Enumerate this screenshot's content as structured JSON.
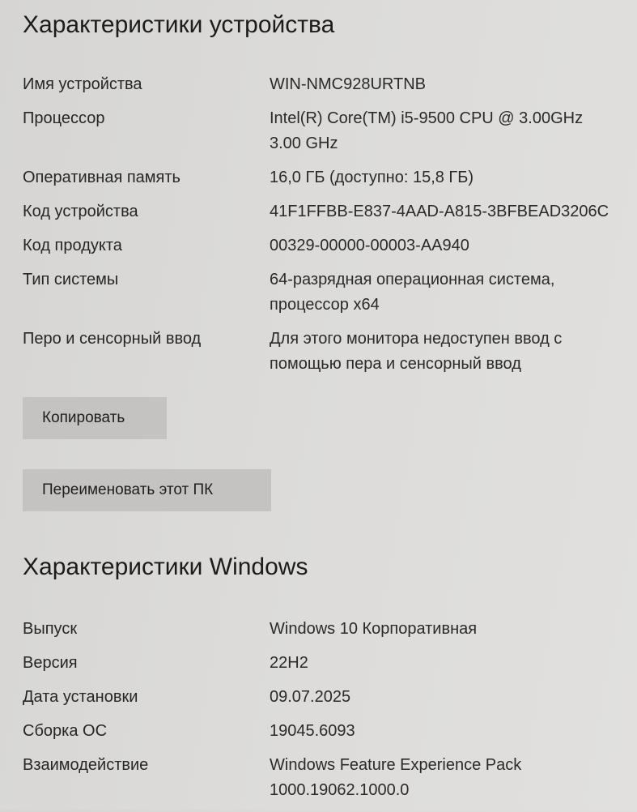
{
  "device_section": {
    "title": "Характеристики устройства",
    "rows": [
      {
        "label": "Имя устройства",
        "value": "WIN-NMC928URTNB"
      },
      {
        "label": "Процессор",
        "value": "Intel(R) Core(TM) i5-9500 CPU @ 3.00GHz\n3.00 GHz"
      },
      {
        "label": "Оперативная память",
        "value": "16,0 ГБ (доступно: 15,8 ГБ)"
      },
      {
        "label": "Код устройства",
        "value": "41F1FFBB-E837-4AAD-A815-3BFBEAD3206C"
      },
      {
        "label": "Код продукта",
        "value": "00329-00000-00003-AA940"
      },
      {
        "label": "Тип системы",
        "value": "64-разрядная операционная система,\nпроцессор x64"
      },
      {
        "label": "Перо и сенсорный ввод",
        "value": "Для этого монитора недоступен ввод с\nпомощью пера и сенсорный ввод"
      }
    ],
    "copy_button_label": "Копировать",
    "rename_button_label": "Переименовать этот ПК"
  },
  "windows_section": {
    "title": "Характеристики Windows",
    "rows": [
      {
        "label": "Выпуск",
        "value": "Windows 10 Корпоративная"
      },
      {
        "label": "Версия",
        "value": "22H2"
      },
      {
        "label": "Дата установки",
        "value": "09.07.2025"
      },
      {
        "label": "Сборка ОС",
        "value": "19045.6093"
      },
      {
        "label": "Взаимодействие",
        "value": "Windows Feature Experience Pack\n1000.19062.1000.0"
      }
    ]
  }
}
